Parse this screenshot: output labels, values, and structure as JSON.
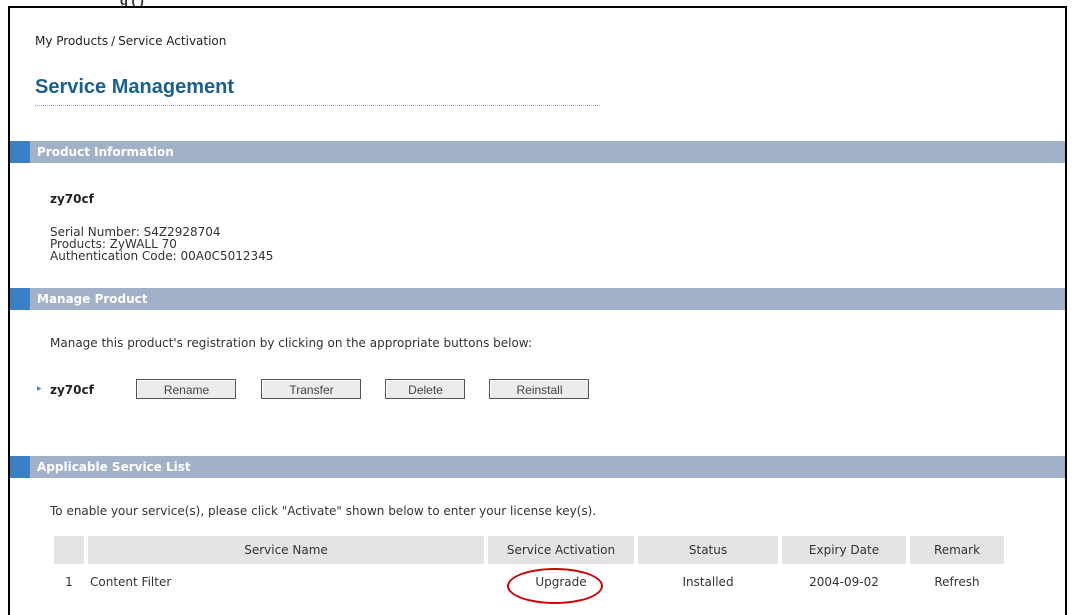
{
  "caption_fragment": "g        (                                    )",
  "breadcrumb": {
    "parent": "My Products",
    "separator": "/",
    "current": "Service Activation"
  },
  "page_title": "Service Management",
  "product_info": {
    "header": "Product Information",
    "name": "zy70cf",
    "serial": "Serial Number: S4Z2928704",
    "product": "Products: ZyWALL 70",
    "auth": "Authentication Code: 00A0C5012345"
  },
  "manage_product": {
    "header": "Manage Product",
    "instructions": "Manage this product's registration by clicking on the appropriate buttons below:",
    "product_name": "zy70cf",
    "buttons": {
      "rename": "Rename",
      "transfer": "Transfer",
      "delete": "Delete",
      "reinstall": "Reinstall"
    }
  },
  "service_list": {
    "header": "Applicable Service List",
    "instructions": "To enable your service(s), please click \"Activate\" shown below to enter your license key(s).",
    "columns": [
      "",
      "Service Name",
      "Service Activation",
      "Status",
      "Expiry Date",
      "Remark"
    ],
    "rows": [
      {
        "index": "1",
        "name": "Content Filter",
        "activation": "Upgrade",
        "status": "Installed",
        "expiry": "2004-09-02",
        "remark": "Refresh"
      }
    ]
  },
  "colors": {
    "section_bar": "#a1b2c8",
    "accent": "#3b7fc4",
    "title": "#1a6090",
    "link": "#1c1fa0",
    "highlight": "#d00000"
  }
}
